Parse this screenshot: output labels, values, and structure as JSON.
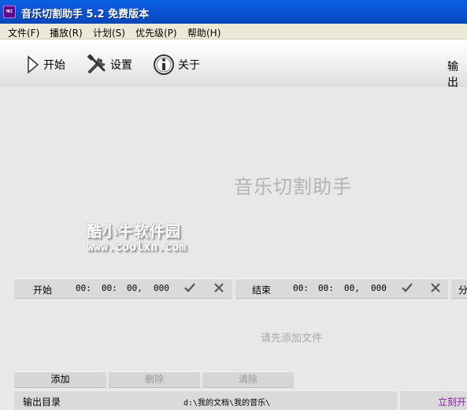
{
  "window": {
    "icon_text": "MCC",
    "title": "音乐切割助手 5.2 免费版本"
  },
  "menu": [
    "文件(F)",
    "播放(R)",
    "计划(S)",
    "优先级(P)",
    "帮助(H)"
  ],
  "toolbar": {
    "start_label": "开始",
    "settings_label": "设置",
    "about_label": "关于",
    "output_label": "输出"
  },
  "main": {
    "app_title": "音乐切割助手",
    "watermark_line1": "酷小牛软件园",
    "watermark_line2": "www.coolxn.com",
    "drop_hint": "请先添加文件"
  },
  "start_time": {
    "label": "开始",
    "hh": "00:",
    "mm": "00:",
    "ss": "00,",
    "ms": "000"
  },
  "end_time": {
    "label": "结束",
    "hh": "00:",
    "mm": "00:",
    "ss": "00,",
    "ms": "000"
  },
  "split_label": "分",
  "buttons": {
    "add": "添加",
    "delete": "删除",
    "clear": "清除"
  },
  "output_dir": {
    "label": "输出目录",
    "value": "d:\\我的文档\\我的音乐\\"
  },
  "convert_label": "立刻开",
  "colors": {
    "titlebar": "#0b55d6",
    "convert_text": "#8a1aa8"
  }
}
